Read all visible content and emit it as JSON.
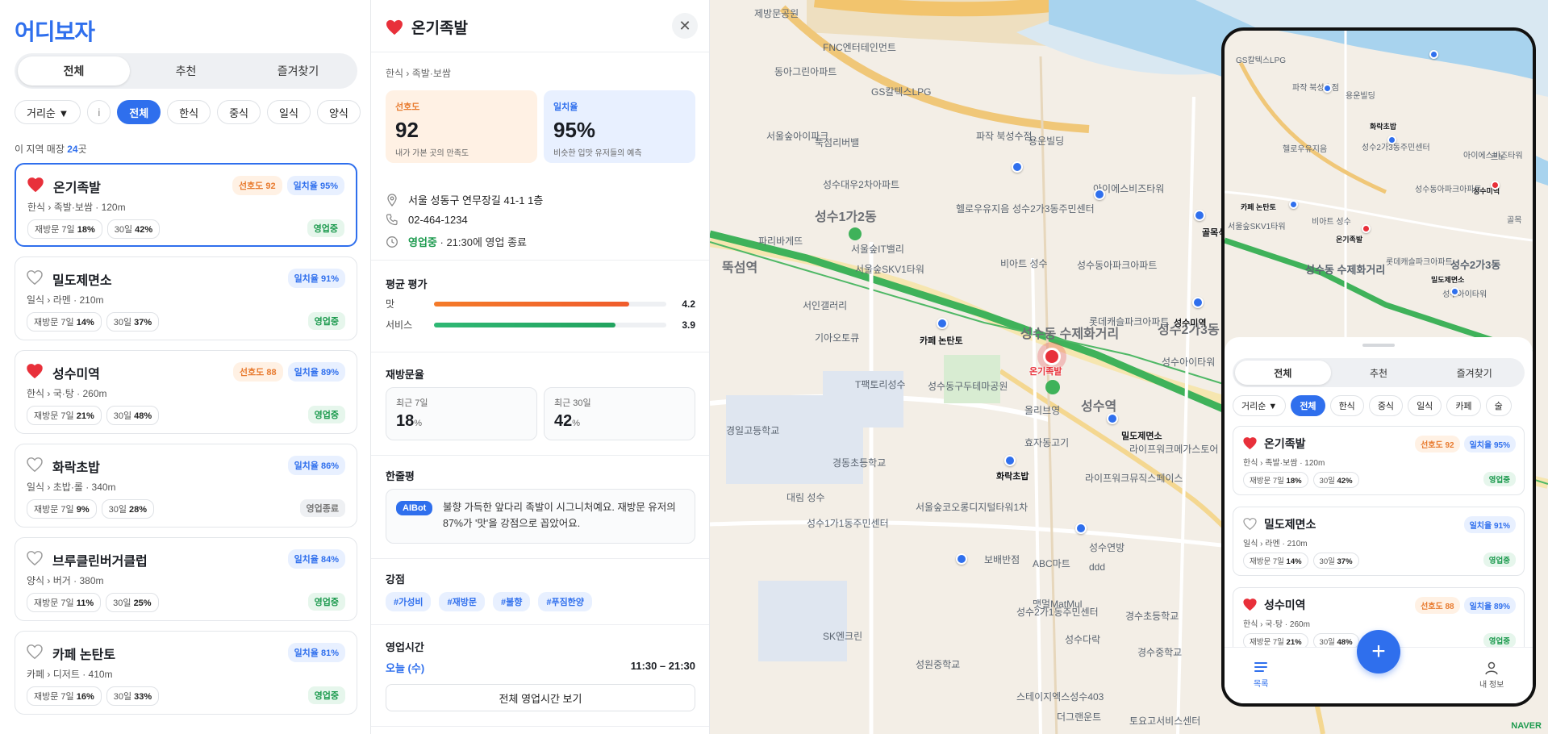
{
  "app": {
    "logo": "어디보자"
  },
  "tabs": [
    "전체",
    "추천",
    "즐겨찾기"
  ],
  "filters": {
    "sort": "거리순 ▼",
    "info": "i",
    "categories": [
      "전체",
      "한식",
      "중식",
      "일식",
      "양식"
    ]
  },
  "count": {
    "prefix": "이 지역 매장 ",
    "num": "24",
    "suffix": "곳"
  },
  "places": [
    {
      "name": "온기족발",
      "fav": true,
      "sub": "한식 › 족발·보쌈 · 120m",
      "pref": "선호도 92",
      "match": "일치율 95%",
      "r7": "재방문 7일 ",
      "r7v": "18%",
      "r30": "30일 ",
      "r30v": "42%",
      "status": "영업중",
      "open": true
    },
    {
      "name": "밀도제면소",
      "fav": false,
      "sub": "일식 › 라멘 · 210m",
      "pref": "",
      "match": "일치율 91%",
      "r7": "재방문 7일 ",
      "r7v": "14%",
      "r30": "30일 ",
      "r30v": "37%",
      "status": "영업중",
      "open": true
    },
    {
      "name": "성수미역",
      "fav": true,
      "sub": "한식 › 국·탕 · 260m",
      "pref": "선호도 88",
      "match": "일치율 89%",
      "r7": "재방문 7일 ",
      "r7v": "21%",
      "r30": "30일 ",
      "r30v": "48%",
      "status": "영업중",
      "open": true
    },
    {
      "name": "화락초밥",
      "fav": false,
      "sub": "일식 › 초밥·롤 · 340m",
      "pref": "",
      "match": "일치율 86%",
      "r7": "재방문 7일 ",
      "r7v": "9%",
      "r30": "30일 ",
      "r30v": "28%",
      "status": "영업종료",
      "open": false
    },
    {
      "name": "브루클린버거클럽",
      "fav": false,
      "sub": "양식 › 버거 · 380m",
      "pref": "",
      "match": "일치율 84%",
      "r7": "재방문 7일 ",
      "r7v": "11%",
      "r30": "30일 ",
      "r30v": "25%",
      "status": "영업중",
      "open": true
    },
    {
      "name": "카페 논탄토",
      "fav": false,
      "sub": "카페 › 디저트 · 410m",
      "pref": "",
      "match": "일치율 81%",
      "r7": "재방문 7일 ",
      "r7v": "16%",
      "r30": "30일 ",
      "r30v": "33%",
      "status": "영업중",
      "open": true
    }
  ],
  "detail": {
    "title": "온기족발",
    "category": "한식 › 족발·보쌈",
    "pref": {
      "label": "선호도",
      "value": "92",
      "caption": "내가 가본 곳의 만족도"
    },
    "match": {
      "label": "일치율",
      "value": "95%",
      "caption": "비슷한 입맛 유저들의 예측"
    },
    "address": "서울 성동구 연무장길 41-1 1층",
    "phone": "02-464-1234",
    "status": "영업중",
    "status_note": "· 21:30에 영업 종료",
    "ratings_title": "평균 평가",
    "ratings": [
      {
        "label": "맛",
        "value": 4.2,
        "display": "4.2"
      },
      {
        "label": "서비스",
        "value": 3.9,
        "display": "3.9"
      }
    ],
    "revisit_title": "재방문율",
    "revisit": [
      {
        "label": "최근 7일",
        "value": "18",
        "unit": "%"
      },
      {
        "label": "최근 30일",
        "value": "42",
        "unit": "%"
      }
    ],
    "review_title": "한줄평",
    "ai_tag": "AIBot",
    "review": "불향 가득한 앞다리 족발이 시그니처예요. 재방문 유저의 87%가 '맛'을 강점으로 꼽았어요.",
    "strengths_title": "강점",
    "strengths": [
      "#가성비",
      "#재방문",
      "#불향",
      "#푸짐한양"
    ],
    "hours_title": "영업시간",
    "today": "오늘 (수)",
    "hours": "11:30 – 21:30",
    "all_hours_btn": "전체 영업시간 보기"
  },
  "map": {
    "labels": [
      "제방문공원",
      "동아그린아파트",
      "FNC엔터테인먼트",
      "GS칼텍스LPG",
      "서울숲아이파크",
      "뚝섬리버밸",
      "파작 북성수점",
      "용운빌딩",
      "성수대우2차아파트",
      "헬로우유지음",
      "성수2가3동주민센터",
      "아이에스비즈타워",
      "파리바게뜨",
      "서울숲IT밸리",
      "비아트 성수",
      "서울숲SKV1타워",
      "성수동아파크아파트",
      "서인갤러리",
      "기아오토큐",
      "롯데캐슬파크아파트",
      "T팩토리성수",
      "성수동구두테마공원",
      "올리브영",
      "효자동고기",
      "성수아이타워",
      "라이프워크메가스토어",
      "경일고등학교",
      "경동초등학교",
      "대림 성수",
      "라이프워크뮤직스페이스",
      "성수1가1동주민센터",
      "서울숲코오롱디지털타워1차",
      "보배반점",
      "ABC마트",
      "성수연방",
      "ddd",
      "성수2가1동주민센터",
      "맷멀MatMul",
      "성수다락",
      "SK엔크린",
      "성원중학교",
      "스테이지엑스성수403",
      "더그랜운트",
      "토요고서비스센터",
      "경수초등학교",
      "경수중학교",
      "뚝섬역",
      "성수역",
      "성수1가2동",
      "성수동 수제화거리",
      "성수2가3동",
      "카페 논탄토",
      "화락초밥",
      "밀도제면소",
      "성수미역",
      "골목식당"
    ],
    "selected_label": "온기족발",
    "naver": "NAVER"
  },
  "phone": {
    "tabs": [
      "전체",
      "추천",
      "즐겨찾기"
    ],
    "chips": [
      "거리순 ▼",
      "전체",
      "한식",
      "중식",
      "일식",
      "카페",
      "술"
    ],
    "nav_list": "목록",
    "nav_me": "내 정보",
    "fab": "+",
    "map_labels": [
      "GS칼텍스LPG",
      "파작 북성수점",
      "용운빌딩",
      "화락초밥",
      "헬로우유지음",
      "성수2가3동주민센터",
      "카페 논탄토",
      "서울숲SKV1타워",
      "비아트 성수",
      "온기족발",
      "아이에스비즈타워",
      "성수미역",
      "성수동아파크아파트",
      "성수동 수제화거리",
      "롯데캐슬파크아파트",
      "밀도제면소",
      "성수2가3동",
      "성수아이타워",
      "르노",
      "골목"
    ]
  }
}
